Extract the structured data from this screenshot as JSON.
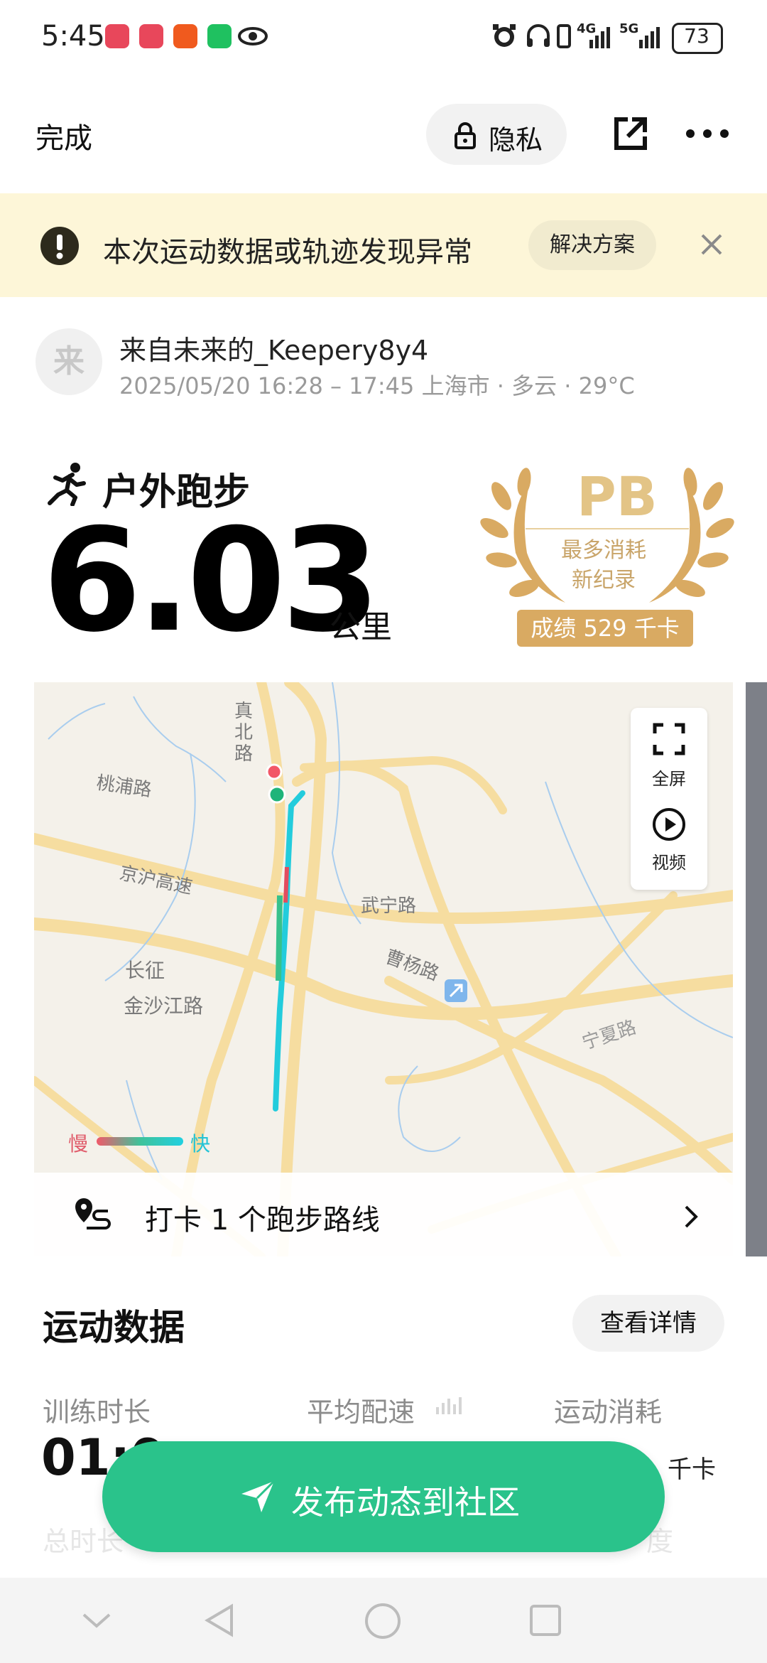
{
  "status_bar": {
    "time": "5:45",
    "network_1": "4G",
    "network_2": "5G",
    "battery": "73",
    "icons": [
      "app-red-icon",
      "app-red-icon",
      "taobao-icon",
      "wechat-icon",
      "eye-icon",
      "alarm-icon",
      "headphones-icon",
      "vibrate-icon",
      "signal-icon",
      "battery-icon"
    ]
  },
  "nav": {
    "done_label": "完成",
    "privacy_label": "隐私"
  },
  "banner": {
    "message": "本次运动数据或轨迹发现异常",
    "solution_label": "解决方案"
  },
  "author": {
    "avatar_char": "来",
    "name": "来自未来的_Keepery8y4",
    "meta": "2025/05/20 16:28 – 17:45 上海市 · 多云 · 29°C"
  },
  "sport": {
    "type_label": "户外跑步",
    "distance": "6.03",
    "unit": "公里"
  },
  "pb": {
    "title": "PB",
    "subtitle_line1": "最多消耗",
    "subtitle_line2": "新纪录",
    "badge": "成绩 529 千卡"
  },
  "map": {
    "fullscreen_label": "全屏",
    "video_label": "视频",
    "legend_slow": "慢",
    "legend_fast": "快",
    "roads": [
      "桃浦路",
      "真北路",
      "京沪高速",
      "武宁路",
      "曹杨路",
      "长征",
      "金沙江路",
      "宁夏路"
    ],
    "checkin_text": "打卡 1 个跑步路线",
    "colors": {
      "route_fast": "#21d0e0",
      "route_mid": "#3fc29a",
      "route_slow": "#f05a6a",
      "start": "#1fb47a",
      "end": "#f25767"
    }
  },
  "data_section": {
    "title": "运动数据",
    "details_label": "查看详情",
    "stats": [
      {
        "label": "训练时长",
        "value": "01:0"
      },
      {
        "label": "平均配速",
        "value": ""
      },
      {
        "label": "运动消耗",
        "value": "千卡"
      }
    ],
    "faded_labels": [
      "总时长",
      "度"
    ]
  },
  "publish": {
    "label": "发布动态到社区",
    "color": "#2ac38b"
  },
  "colors": {
    "banner_bg": "#fdf6d8",
    "pb_gold": "#d9aa62"
  }
}
